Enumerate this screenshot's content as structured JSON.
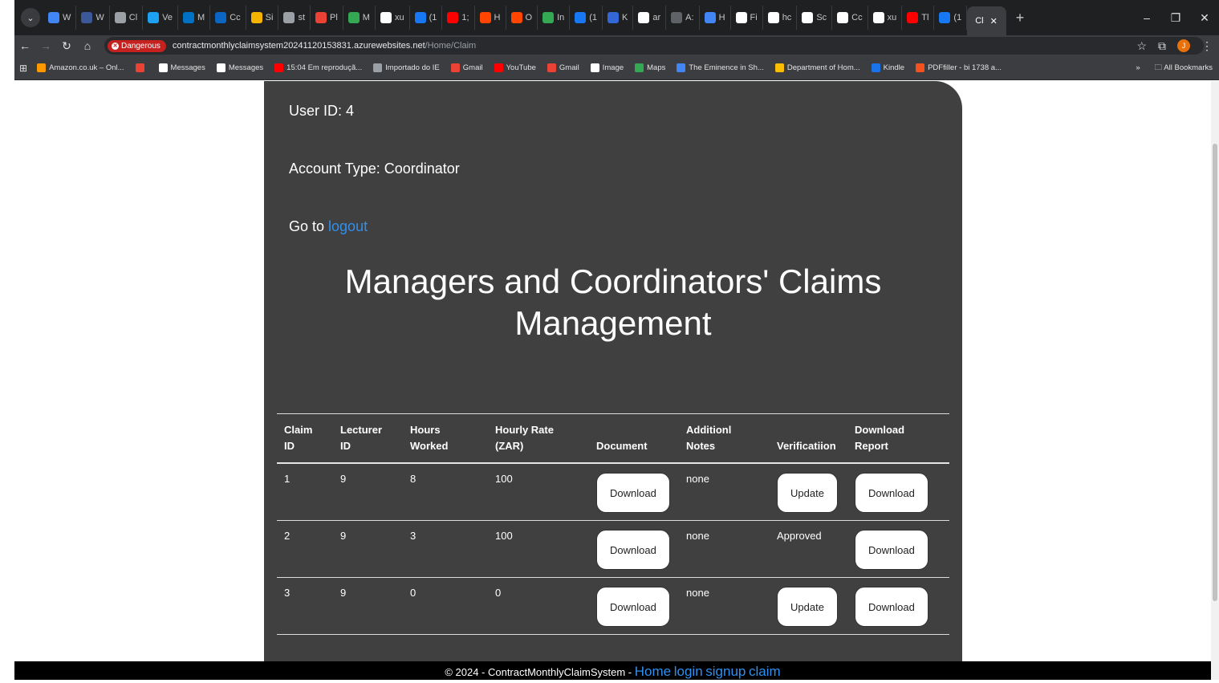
{
  "browser": {
    "tabs": [
      {
        "label": "W",
        "color": "#4285f4"
      },
      {
        "label": "W",
        "color": "#3b5998"
      },
      {
        "label": "Cl",
        "color": "#9aa0a6"
      },
      {
        "label": "Ve",
        "color": "#1da1f2"
      },
      {
        "label": "M",
        "color": "#0072c6"
      },
      {
        "label": "Cc",
        "color": "#0a66c2"
      },
      {
        "label": "Si",
        "color": "#f4b400"
      },
      {
        "label": "st",
        "color": "#9aa0a6"
      },
      {
        "label": "Pl",
        "color": "#ea4335"
      },
      {
        "label": "M",
        "color": "#34a853"
      },
      {
        "label": "xu",
        "color": "#ffffff"
      },
      {
        "label": "(1",
        "color": "#1877f2"
      },
      {
        "label": "1;",
        "color": "#ff0000"
      },
      {
        "label": "H",
        "color": "#ff4500"
      },
      {
        "label": "O",
        "color": "#ff4500"
      },
      {
        "label": "In",
        "color": "#34a853"
      },
      {
        "label": "(1",
        "color": "#1877f2"
      },
      {
        "label": "K",
        "color": "#3367d6"
      },
      {
        "label": "ar",
        "color": "#ffffff"
      },
      {
        "label": "A:",
        "color": "#5f6368"
      },
      {
        "label": "H",
        "color": "#4285f4"
      },
      {
        "label": "Fi",
        "color": "#ffffff"
      },
      {
        "label": "hc",
        "color": "#ffffff"
      },
      {
        "label": "Sc",
        "color": "#ffffff"
      },
      {
        "label": "Cc",
        "color": "#ffffff"
      },
      {
        "label": "xu",
        "color": "#ffffff"
      },
      {
        "label": "Tl",
        "color": "#ff0000"
      },
      {
        "label": "(1",
        "color": "#1877f2"
      }
    ],
    "active_tab": "Cl",
    "url_badge": "Dangerous",
    "url_host": "contractmonthlyclaimsystem20241120153831.azurewebsites.net",
    "url_path": "/Home/Claim",
    "profile_initial": "J",
    "bookmarks": [
      {
        "label": "Amazon.co.uk – Onl...",
        "color": "#ff9900"
      },
      {
        "label": "",
        "color": "#ea4335"
      },
      {
        "label": "Messages",
        "color": "#ffffff"
      },
      {
        "label": "Messages",
        "color": "#ffffff"
      },
      {
        "label": "15:04 Em reproduçã...",
        "color": "#ff0000"
      },
      {
        "label": "Importado do IE",
        "color": "#9aa0a6"
      },
      {
        "label": "Gmail",
        "color": "#ea4335"
      },
      {
        "label": "YouTube",
        "color": "#ff0000"
      },
      {
        "label": "Gmail",
        "color": "#ea4335"
      },
      {
        "label": "Image",
        "color": "#ffffff"
      },
      {
        "label": "Maps",
        "color": "#34a853"
      },
      {
        "label": "The Eminence in Sh...",
        "color": "#4285f4"
      },
      {
        "label": "Department of Hom...",
        "color": "#fbbc04"
      },
      {
        "label": "Kindle",
        "color": "#1a73e8"
      },
      {
        "label": "PDFfiller - bi 1738 a...",
        "color": "#f4511e"
      }
    ],
    "bookmarks_more": "»",
    "all_bookmarks": "All Bookmarks"
  },
  "page": {
    "user_id_label": "User ID: 4",
    "account_type_label": "Account Type: Coordinator",
    "goto_prefix": "Go to ",
    "logout_link": "logout",
    "heading_line1": "Managers and Coordinators' Claims",
    "heading_line2": "Management",
    "table": {
      "headers": {
        "claim_id_1": "Claim",
        "claim_id_2": "ID",
        "lecturer_id_1": "Lecturer",
        "lecturer_id_2": "ID",
        "hours_1": "Hours",
        "hours_2": "Worked",
        "rate_1": "Hourly Rate",
        "rate_2": "(ZAR)",
        "document": "Document",
        "notes_1": "Additionl",
        "notes_2": "Notes",
        "verification": "Verificatiion",
        "report_1": "Download",
        "report_2": "Report"
      },
      "rows": [
        {
          "claim_id": "1",
          "lecturer_id": "9",
          "hours": "8",
          "rate": "100",
          "document_btn": "Download",
          "notes": "none",
          "verification_btn": "Update",
          "verification_text": "",
          "report_btn": "Download"
        },
        {
          "claim_id": "2",
          "lecturer_id": "9",
          "hours": "3",
          "rate": "100",
          "document_btn": "Download",
          "notes": "none",
          "verification_btn": "",
          "verification_text": "Approved",
          "report_btn": "Download"
        },
        {
          "claim_id": "3",
          "lecturer_id": "9",
          "hours": "0",
          "rate": "0",
          "document_btn": "Download",
          "notes": "none",
          "verification_btn": "Update",
          "verification_text": "",
          "report_btn": "Download"
        }
      ]
    }
  },
  "footer": {
    "copyright": "© 2024 - ContractMonthlyClaimSystem - ",
    "links": [
      "Home",
      "login",
      "signup",
      "claim"
    ]
  }
}
